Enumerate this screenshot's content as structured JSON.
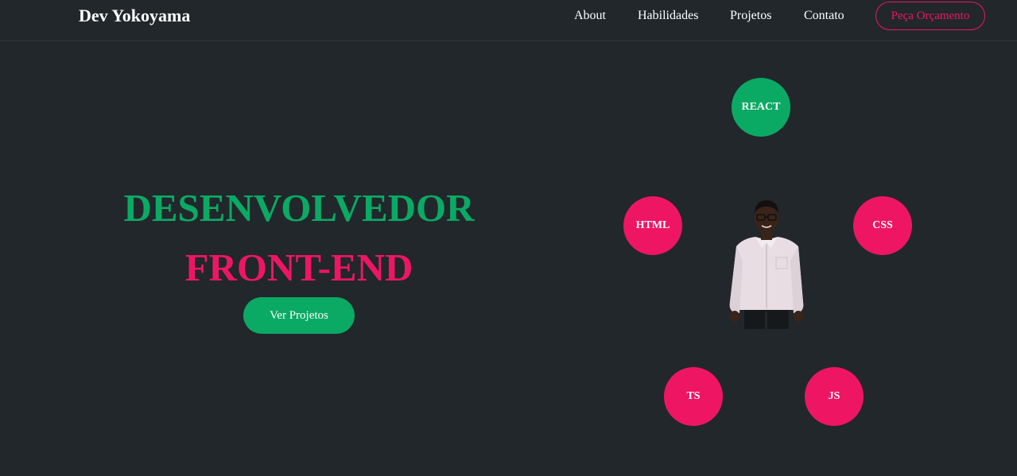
{
  "nav": {
    "brand": "Dev Yokoyama",
    "links": [
      "About",
      "Habilidades",
      "Projetos",
      "Contato"
    ],
    "cta_label": "Peça Orçamento"
  },
  "hero": {
    "title_line1": "DESENVOLVEDOR",
    "title_line2": "FRONT-END",
    "button_label": "Ver Projetos"
  },
  "skills": [
    {
      "label": "REACT",
      "color": "#0aaa64"
    },
    {
      "label": "HTML",
      "color": "#ee1663"
    },
    {
      "label": "CSS",
      "color": "#ee1663"
    },
    {
      "label": "TS",
      "color": "#ee1663"
    },
    {
      "label": "JS",
      "color": "#ee1663"
    }
  ],
  "colors": {
    "background": "#22272b",
    "accent_green": "#0aaa64",
    "accent_pink": "#ee1663"
  }
}
